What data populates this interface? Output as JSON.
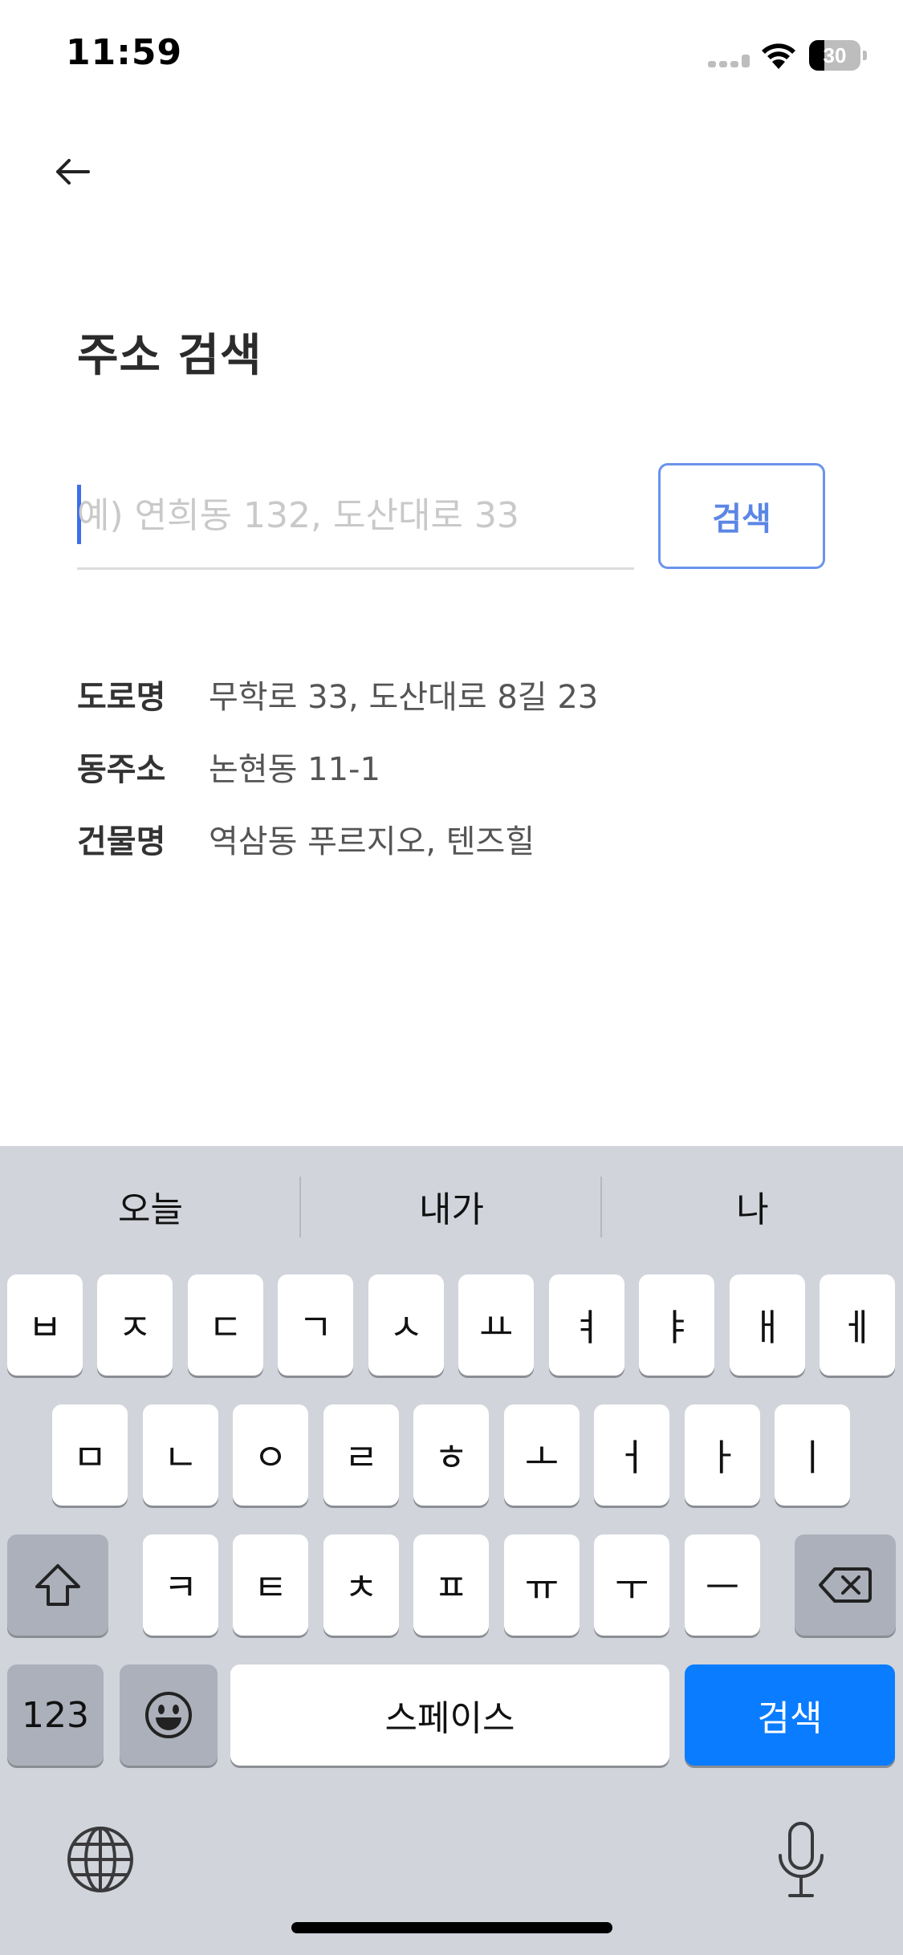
{
  "status_bar": {
    "time": "11:59",
    "battery_level": "30"
  },
  "header": {
    "back_icon": "arrow-left-icon",
    "title": "주소 검색"
  },
  "search": {
    "placeholder": "예) 연희동 132, 도산대로 33",
    "value": "",
    "button_label": "검색",
    "accent_color": "#5b86e5"
  },
  "hints": [
    {
      "label": "도로명",
      "value": "무학로 33, 도산대로 8길 23"
    },
    {
      "label": "동주소",
      "value": "논현동 11-1"
    },
    {
      "label": "건물명",
      "value": "역삼동 푸르지오, 텐즈힐"
    }
  ],
  "keyboard": {
    "suggestions": [
      "오늘",
      "내가",
      "나"
    ],
    "row1": [
      "ㅂ",
      "ㅈ",
      "ㄷ",
      "ㄱ",
      "ㅅ",
      "ㅛ",
      "ㅕ",
      "ㅑ",
      "ㅐ",
      "ㅔ"
    ],
    "row2": [
      "ㅁ",
      "ㄴ",
      "ㅇ",
      "ㄹ",
      "ㅎ",
      "ㅗ",
      "ㅓ",
      "ㅏ",
      "ㅣ"
    ],
    "row3": [
      "ㅋ",
      "ㅌ",
      "ㅊ",
      "ㅍ",
      "ㅠ",
      "ㅜ",
      "ㅡ"
    ],
    "shift_icon": "shift-icon",
    "delete_icon": "backspace-icon",
    "numbers_label": "123",
    "emoji_icon": "emoji-icon",
    "space_label": "스페이스",
    "return_label": "검색",
    "globe_icon": "globe-icon",
    "mic_icon": "microphone-icon",
    "return_color": "#0a7cff"
  }
}
